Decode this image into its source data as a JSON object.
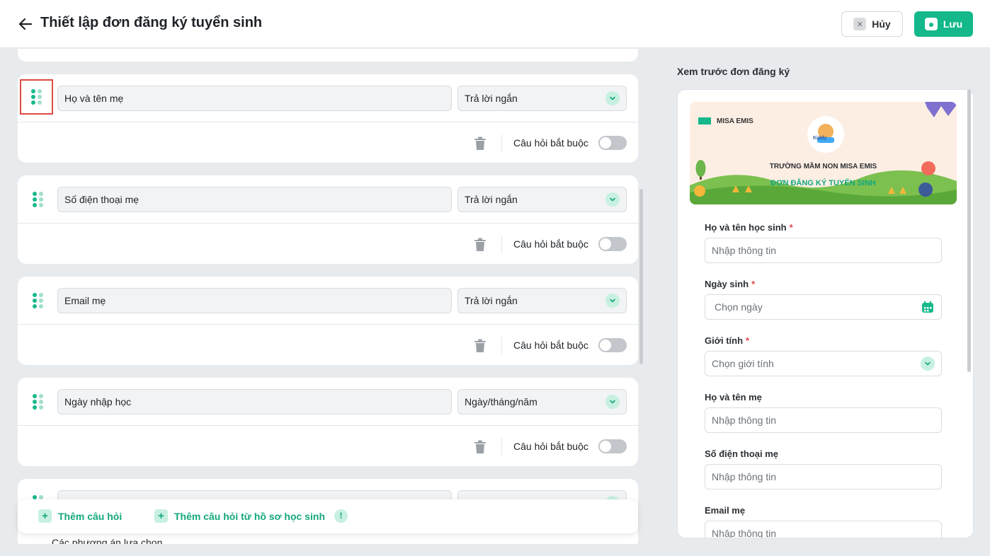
{
  "header": {
    "title": "Thiết lập đơn đăng ký tuyển sinh",
    "cancel_label": "Hủy",
    "save_label": "Lưu"
  },
  "questions": [
    {
      "label": "Họ và tên mẹ",
      "type": "Trả lời ngắn",
      "required_label": "Câu hỏi bắt buộc",
      "required": false
    },
    {
      "label": "Số điện thoại mẹ",
      "type": "Trả lời ngắn",
      "required_label": "Câu hỏi bắt buộc",
      "required": false
    },
    {
      "label": "Email mẹ",
      "type": "Trả lời ngắn",
      "required_label": "Câu hỏi bắt buộc",
      "required": false
    },
    {
      "label": "Ngày nhập học",
      "type": "Ngày/tháng/năm",
      "required_label": "Câu hỏi bắt buộc",
      "required": false
    }
  ],
  "partial_card": {
    "options_label": "Các phương án lựa chọn"
  },
  "add_bar": {
    "add_question": "Thêm câu hỏi",
    "add_from_profile": "Thêm câu hỏi từ hồ sơ học sinh",
    "info_glyph": "!"
  },
  "preview": {
    "label": "Xem trước đơn đăng ký",
    "banner": {
      "brand": "MISA EMIS",
      "mascot": "Kiddy",
      "school": "TRƯỜNG MẦM NON MISA EMIS",
      "form_title": "ĐƠN ĐĂNG KÝ TUYỂN SINH"
    },
    "fields": [
      {
        "label": "Họ và tên học sinh",
        "required": "*",
        "placeholder": "Nhập thông tin"
      },
      {
        "label": "Ngày sinh",
        "required": "*",
        "placeholder": "Chọn ngày"
      },
      {
        "label": "Giới tính",
        "required": "*",
        "placeholder": "Chọn giới tính"
      },
      {
        "label": "Họ và tên mẹ",
        "placeholder": "Nhập thông tin"
      },
      {
        "label": "Số điện thoại mẹ",
        "placeholder": "Nhập thông tin"
      },
      {
        "label": "Email mẹ",
        "placeholder": "Nhập thông tin"
      }
    ]
  },
  "colors": {
    "accent": "#14b88a",
    "highlight": "#dc4b43",
    "required_star": "#e5484d"
  },
  "icons": [
    "arrow-left-icon",
    "close-icon",
    "save-icon",
    "drag-handle-icon",
    "chevron-down-icon",
    "trash-icon",
    "plus-icon",
    "info-icon",
    "calendar-icon"
  ]
}
